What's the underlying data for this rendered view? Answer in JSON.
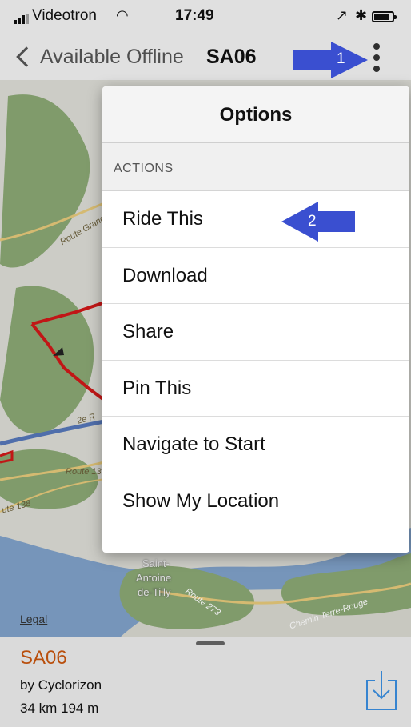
{
  "status_bar": {
    "carrier": "Videotron",
    "time": "17:49"
  },
  "nav": {
    "back_label": "Available Offline",
    "title": "SA06"
  },
  "map": {
    "legal_label": "Legal",
    "labels": {
      "route_grande": "Route Grand",
      "route_138_a": "Route 13",
      "route_138_b": "ute 138",
      "rang": "2e R",
      "town_line1": "Saint-",
      "town_line2": "Antoine",
      "town_line3": "de-Tilly",
      "route_273": "Route 273",
      "chemin": "Chemin Terre-Rouge"
    }
  },
  "options_popover": {
    "title": "Options",
    "section_header": "ACTIONS",
    "items": [
      "Ride This",
      "Download",
      "Share",
      "Pin This",
      "Navigate to Start",
      "Show My Location"
    ]
  },
  "route_panel": {
    "name": "SA06",
    "author": "by Cyclorizon",
    "stats": "34 km 194 m"
  },
  "annotations": {
    "arrow_1": "1",
    "arrow_2": "2"
  },
  "colors": {
    "route_name": "#c8560f",
    "annotation_arrow": "#3a4fd0",
    "route_line": "#d01818",
    "water": "#7fa1c9",
    "land": "#dcdcd6",
    "forest": "#8aa774"
  }
}
